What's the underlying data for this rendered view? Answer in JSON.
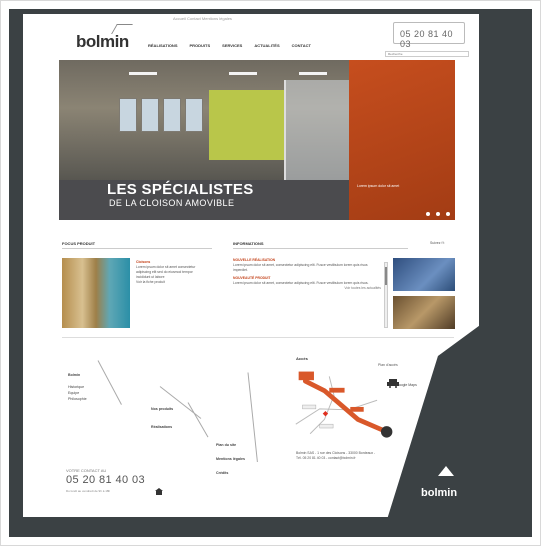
{
  "header": {
    "topbar": "Accueil    Contact    Mentions légales",
    "logo": "bolmin",
    "phone": "05 20 81 40 03",
    "search_placeholder": "Recherche",
    "nav": [
      "RÉALISATIONS",
      "PRODUITS",
      "SERVICES",
      "ACTUALITÉS",
      "CONTACT"
    ]
  },
  "hero": {
    "title": "LES SPÉCIALISTES",
    "subtitle": "DE LA CLOISON AMOVIBLE",
    "side_text": "Lorem ipsum dolor sit amet"
  },
  "focus": {
    "title": "FOCUS PRODUIT",
    "heading": "Cloisons",
    "body": "Lorem ipsum dolor sit amet consectetur adipiscing elit sed do eiusmod tempor incididunt ut labore",
    "more": "Voir la fiche produit"
  },
  "info": {
    "title": "INFORMATIONS",
    "item1_heading": "NOUVELLE RÉALISATION",
    "item1_body": "Lorem ipsum dolor sit amet, consectetur adipiscing elit. Fusce vestibulum lorem quis risus imperdiet.",
    "item2_heading": "NOUVEAUTÉ PRODUIT",
    "item2_body": "Lorem ipsum dolor sit amet, consectetur adipiscing elit. Fusce vestibulum lorem quis risus.",
    "more": "Voir toutes les actualités"
  },
  "social": "Suivez   f  t",
  "footer": {
    "col1": [
      "Bolmin",
      "Historique",
      "Equipe",
      "Philosophie"
    ],
    "col2": [
      "Nos produits",
      "Réalisations"
    ],
    "col3": [
      "Plan du site",
      "Mentions légales",
      "Crédits"
    ],
    "contact_label": "VOTRE CONTACT AU",
    "contact_number": "05 20 81 40 03",
    "contact_small": "Du lundi au vendredi de 9h à 18h",
    "map_title": "Accès",
    "plan_label": "Plan d'accès",
    "gmap_label": "Google Maps",
    "address": "Bolmin SAS - 1 rue des Cloisons - 33000 Bordeaux - Tél. 05 20 81 40 03 - contact@bolmin.fr",
    "brand": "bolmin"
  }
}
